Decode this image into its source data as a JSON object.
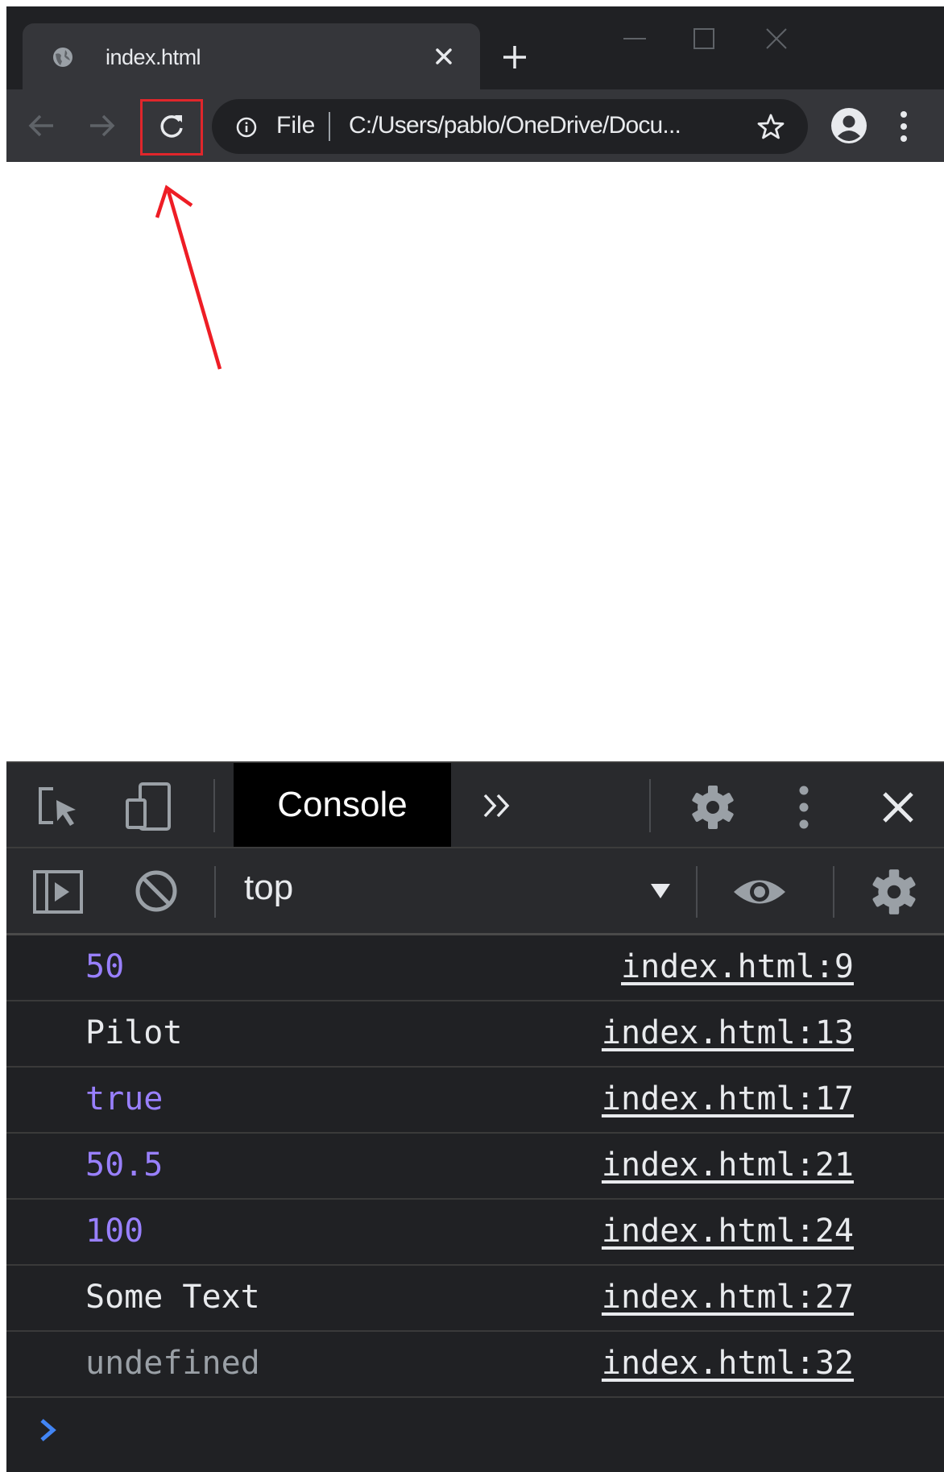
{
  "browser": {
    "tab": {
      "title": "index.html"
    },
    "toolbar": {
      "omnibox_scheme": "File",
      "omnibox_url": "C:/Users/pablo/OneDrive/Docu..."
    }
  },
  "devtools": {
    "active_tab": "Console",
    "context": "top",
    "log": [
      {
        "message": "50",
        "kind": "number",
        "source": "index.html:9"
      },
      {
        "message": "Pilot",
        "kind": "string",
        "source": "index.html:13"
      },
      {
        "message": "true",
        "kind": "boolean",
        "source": "index.html:17"
      },
      {
        "message": "50.5",
        "kind": "number",
        "source": "index.html:21"
      },
      {
        "message": "100",
        "kind": "number",
        "source": "index.html:24"
      },
      {
        "message": "Some Text",
        "kind": "string",
        "source": "index.html:27"
      },
      {
        "message": "undefined",
        "kind": "undefined",
        "source": "index.html:32"
      }
    ]
  },
  "colors": {
    "number_value": "#9980ff",
    "highlight": "#e0262b",
    "prompt": "#4285f4"
  },
  "icons": [
    "globe-icon",
    "close-icon",
    "new-tab-icon",
    "minimize-icon",
    "maximize-icon",
    "window-close-icon",
    "back-icon",
    "forward-icon",
    "reload-icon",
    "info-icon",
    "star-icon",
    "profile-icon",
    "more-icon",
    "inspect-element-icon",
    "device-toolbar-icon",
    "more-tabs-icon",
    "devtools-settings-icon",
    "devtools-more-icon",
    "devtools-close-icon",
    "sidebar-toggle-icon",
    "clear-console-icon",
    "dropdown-arrow-icon",
    "eye-icon",
    "console-settings-icon",
    "prompt-chevron-icon"
  ]
}
